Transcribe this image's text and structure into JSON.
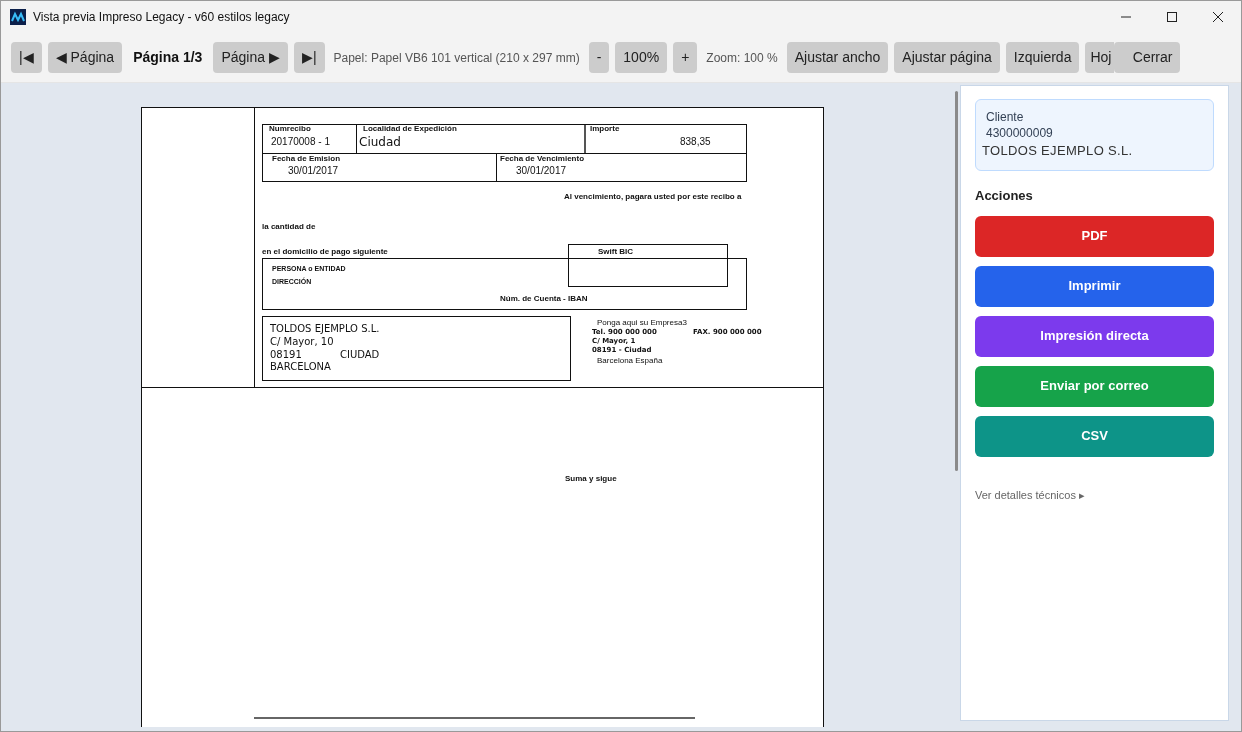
{
  "window": {
    "title": "Vista previa Impreso Legacy - v60 estilos legacy"
  },
  "toolbar": [
    {
      "kind": "button",
      "label": "|◀"
    },
    {
      "kind": "button",
      "label": "◀ Página"
    },
    {
      "kind": "page",
      "label": "Página 1/3"
    },
    {
      "kind": "button",
      "label": "Página ▶"
    },
    {
      "kind": "button",
      "label": "▶|"
    },
    {
      "kind": "info",
      "label": "Papel: Papel VB6 101 vertical (210 x 297 mm)"
    },
    {
      "kind": "button",
      "label": "-"
    },
    {
      "kind": "button",
      "label": "100%"
    },
    {
      "kind": "button",
      "label": "+"
    },
    {
      "kind": "info",
      "label": "Zoom: 100 %"
    },
    {
      "kind": "button",
      "label": "Ajustar ancho"
    },
    {
      "kind": "button",
      "label": "Ajustar página"
    },
    {
      "kind": "button",
      "label": "Izquierda"
    },
    {
      "kind": "covered",
      "label": "Hoj"
    },
    {
      "kind": "button",
      "label": "Cerrar"
    }
  ],
  "document": {
    "receipt_number": {
      "label": "Numrecibo",
      "value": "20170008 - 1"
    },
    "issue_place": {
      "label": "Localidad de Expedición",
      "value": "Ciudad"
    },
    "amount": {
      "label": "Importe",
      "value": "838,35"
    },
    "issue_date": {
      "label": "Fecha de Emision",
      "value": "30/01/2017"
    },
    "due_date": {
      "label": "Fecha de Vencimiento",
      "value": "30/01/2017"
    },
    "due_text": "Al vencimiento, pagara usted por este recibo a",
    "amount_text": "la cantidad de",
    "domicile_text": "en el domicilio de pago siguiente",
    "swift_label": "Swift BIC",
    "bank_lines": [
      "PERSONA o ENTIDAD",
      "DIRECCIÓN"
    ],
    "iban_label": "Núm. de Cuenta - IBAN",
    "address": [
      "TOLDOS EJEMPLO S.L.",
      "C/ Mayor, 10",
      "BARCELONA"
    ],
    "postal_code": "08191",
    "city": "CIUDAD",
    "company_name": "Ponga aqui su Empresa3",
    "tel": {
      "label": "Tel.",
      "value": "900 000 000"
    },
    "fax": {
      "label": "FAX.",
      "value": "900 000 000"
    },
    "company_lines": [
      "C/ Mayor, 1",
      "08191 - Ciudad"
    ],
    "company_country": "Barcelona España",
    "footer": "Suma y sigue"
  },
  "sidebar": {
    "client": {
      "label": "Cliente",
      "code": "4300000009",
      "name": "TOLDOS EJEMPLO S.L."
    },
    "actions_title": "Acciones",
    "actions": [
      {
        "label": "PDF",
        "color": "#dc2626"
      },
      {
        "label": "Imprimir",
        "color": "#2563eb"
      },
      {
        "label": "Impresión directa",
        "color": "#7c3aed"
      },
      {
        "label": "Enviar por correo",
        "color": "#16a34a"
      },
      {
        "label": "CSV",
        "color": "#0d9488"
      }
    ],
    "details_link": "Ver detalles técnicos ▸"
  }
}
